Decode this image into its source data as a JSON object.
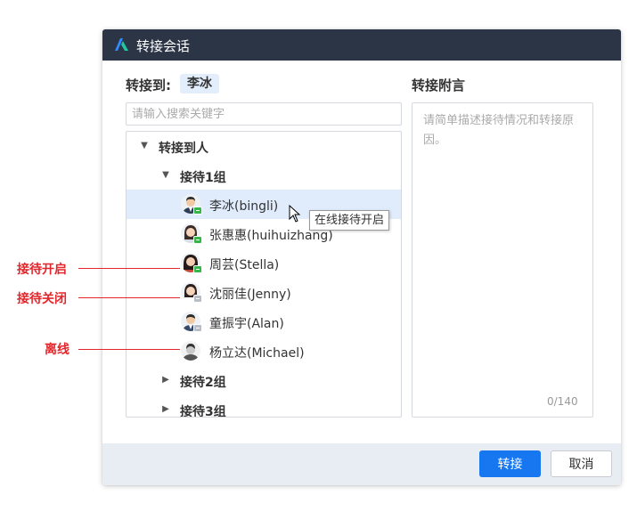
{
  "dialog": {
    "title": "转接会话",
    "transfer_to_label": "转接到:",
    "transfer_target": "李冰",
    "note_label": "转接附言",
    "search_placeholder": "请输入搜索关键字",
    "note_placeholder": "请简单描述接待情况和转接原因。",
    "note_counter": "0/140",
    "confirm_button": "转接",
    "cancel_button": "取消"
  },
  "tree": {
    "root_label": "转接到人",
    "groups": [
      {
        "label": "接待1组",
        "expanded": true,
        "members": [
          {
            "name": "李冰(bingli)",
            "status": "online",
            "selected": true
          },
          {
            "name": "张惠惠(huihuizhang)",
            "status": "online",
            "selected": false
          },
          {
            "name": "周芸(Stella)",
            "status": "online",
            "selected": false
          },
          {
            "name": "沈丽佳(Jenny)",
            "status": "closed",
            "selected": false
          },
          {
            "name": "童振宇(Alan)",
            "status": "closed",
            "selected": false
          },
          {
            "name": "杨立达(Michael)",
            "status": "offline",
            "selected": false
          }
        ]
      },
      {
        "label": "接待2组",
        "expanded": false
      },
      {
        "label": "接待3组",
        "expanded": false
      }
    ]
  },
  "tooltip": "在线接待开启",
  "annotations": {
    "open": "接待开启",
    "closed": "接待关闭",
    "offline": "离线"
  },
  "colors": {
    "titlebar": "#2c3546",
    "primary": "#1677f0",
    "selected_row": "#e0ecfc",
    "status_online": "#34b649",
    "status_closed": "#b7bec8",
    "annotation": "#e3262b"
  },
  "icons": {
    "logo": "brand-logo-icon",
    "expanded_caret": "caret-down-icon",
    "collapsed_caret": "caret-right-icon",
    "online_status": "chat-bubble-green-icon",
    "closed_status": "chat-bubble-gray-icon",
    "cursor": "mouse-pointer-icon"
  }
}
